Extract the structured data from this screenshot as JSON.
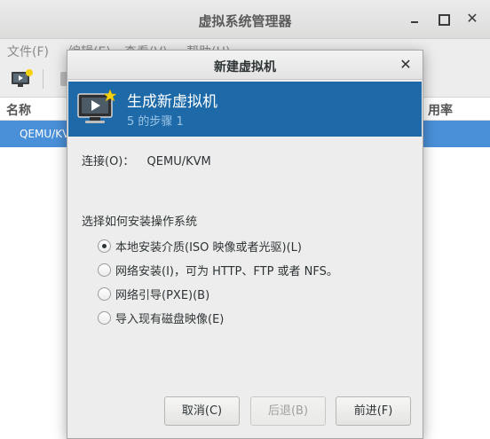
{
  "main_window": {
    "title": "虚拟系统管理器",
    "menu": {
      "file": "文件(F)",
      "edit": "编辑(E)",
      "view": "查看(V)",
      "help": "帮助(H)"
    },
    "list": {
      "col_name": "名称",
      "col_cpu": "用率",
      "row_label": "QEMU/KVM"
    }
  },
  "dialog": {
    "title": "新建虚拟机",
    "banner_title": "生成新虚拟机",
    "banner_subtitle": "5 的步骤 1",
    "connection_label": "连接(O)：",
    "connection_value": "QEMU/KVM",
    "choose_label": "选择如何安装操作系统",
    "options": [
      {
        "label": "本地安装介质(ISO 映像或者光驱)(L)",
        "selected": true
      },
      {
        "label": "网络安装(I)，可为 HTTP、FTP 或者 NFS。",
        "selected": false
      },
      {
        "label": "网络引导(PXE)(B)",
        "selected": false
      },
      {
        "label": "导入现有磁盘映像(E)",
        "selected": false
      }
    ],
    "buttons": {
      "cancel": "取消(C)",
      "back": "后退(B)",
      "forward": "前进(F)"
    }
  },
  "colors": {
    "banner": "#1e6aa8",
    "selection": "#4a90d9"
  }
}
